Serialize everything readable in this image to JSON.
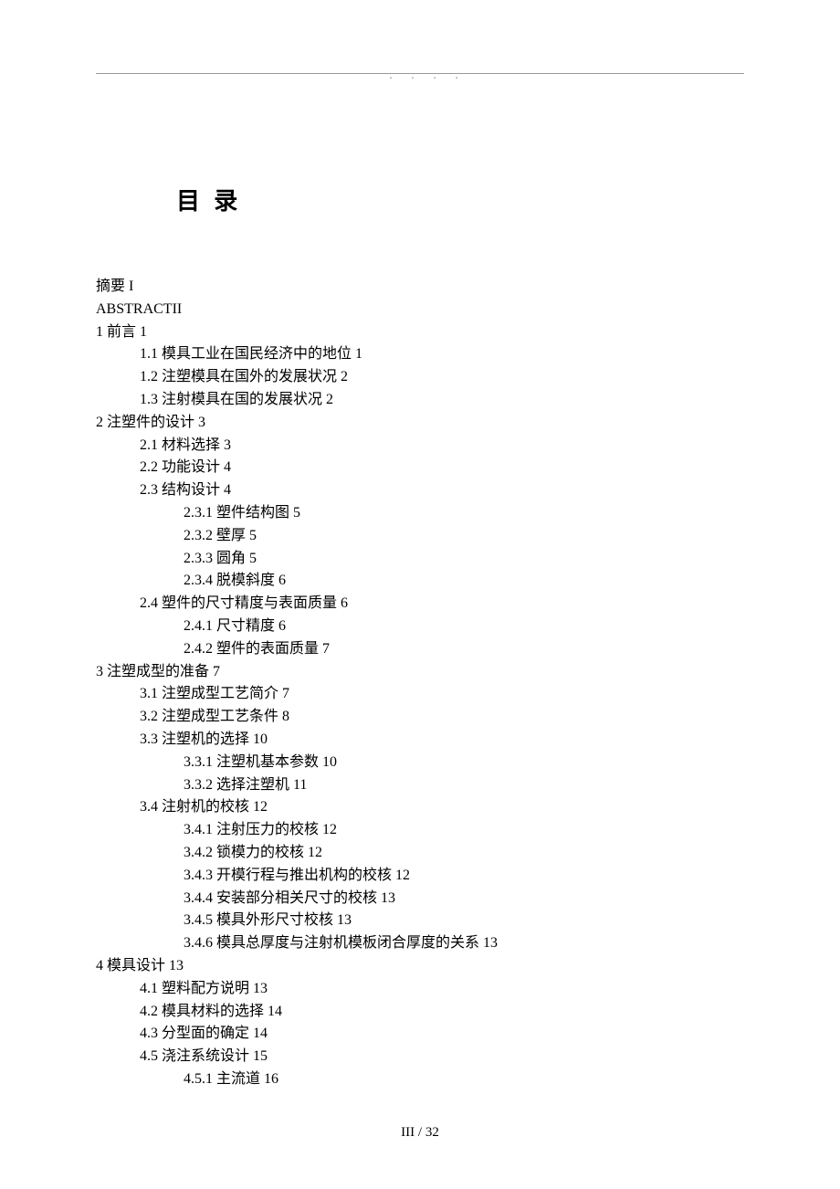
{
  "title": "目 录",
  "footer": "III / 32",
  "toc": [
    {
      "level": 0,
      "text": "摘要 I"
    },
    {
      "level": 0,
      "text": "ABSTRACTII"
    },
    {
      "level": 0,
      "text": "1 前言 1"
    },
    {
      "level": 1,
      "text": "1.1 模具工业在国民经济中的地位 1"
    },
    {
      "level": 1,
      "text": "1.2 注塑模具在国外的发展状况 2"
    },
    {
      "level": 1,
      "text": "1.3 注射模具在国的发展状况 2"
    },
    {
      "level": 0,
      "text": "2 注塑件的设计 3"
    },
    {
      "level": 1,
      "text": "2.1 材料选择 3"
    },
    {
      "level": 1,
      "text": "2.2 功能设计 4"
    },
    {
      "level": 1,
      "text": "2.3 结构设计 4"
    },
    {
      "level": 2,
      "text": "2.3.1 塑件结构图 5"
    },
    {
      "level": 2,
      "text": "2.3.2 壁厚 5"
    },
    {
      "level": 2,
      "text": "2.3.3 圆角 5"
    },
    {
      "level": 2,
      "text": "2.3.4 脱模斜度 6"
    },
    {
      "level": 1,
      "text": "2.4 塑件的尺寸精度与表面质量 6"
    },
    {
      "level": 2,
      "text": "2.4.1 尺寸精度 6"
    },
    {
      "level": 2,
      "text": "2.4.2 塑件的表面质量 7"
    },
    {
      "level": 0,
      "text": "3 注塑成型的准备 7"
    },
    {
      "level": 1,
      "text": "3.1 注塑成型工艺简介 7"
    },
    {
      "level": 1,
      "text": "3.2 注塑成型工艺条件 8"
    },
    {
      "level": 1,
      "text": "3.3 注塑机的选择 10"
    },
    {
      "level": 2,
      "text": "3.3.1 注塑机基本参数 10"
    },
    {
      "level": 2,
      "text": "3.3.2 选择注塑机 11"
    },
    {
      "level": 1,
      "text": "3.4 注射机的校核 12"
    },
    {
      "level": 2,
      "text": "3.4.1 注射压力的校核 12"
    },
    {
      "level": 2,
      "text": "3.4.2 锁模力的校核 12"
    },
    {
      "level": 2,
      "text": "3.4.3 开模行程与推出机构的校核 12"
    },
    {
      "level": 2,
      "text": "3.4.4 安装部分相关尺寸的校核 13"
    },
    {
      "level": 2,
      "text": "3.4.5 模具外形尺寸校核 13"
    },
    {
      "level": 2,
      "text": "3.4.6 模具总厚度与注射机模板闭合厚度的关系 13"
    },
    {
      "level": 0,
      "text": "4 模具设计 13"
    },
    {
      "level": 1,
      "text": "4.1 塑料配方说明 13"
    },
    {
      "level": 1,
      "text": "4.2 模具材料的选择 14"
    },
    {
      "level": 1,
      "text": "4.3 分型面的确定 14"
    },
    {
      "level": 1,
      "text": "4.5 浇注系统设计 15"
    },
    {
      "level": 2,
      "text": "4.5.1 主流道 16"
    }
  ]
}
